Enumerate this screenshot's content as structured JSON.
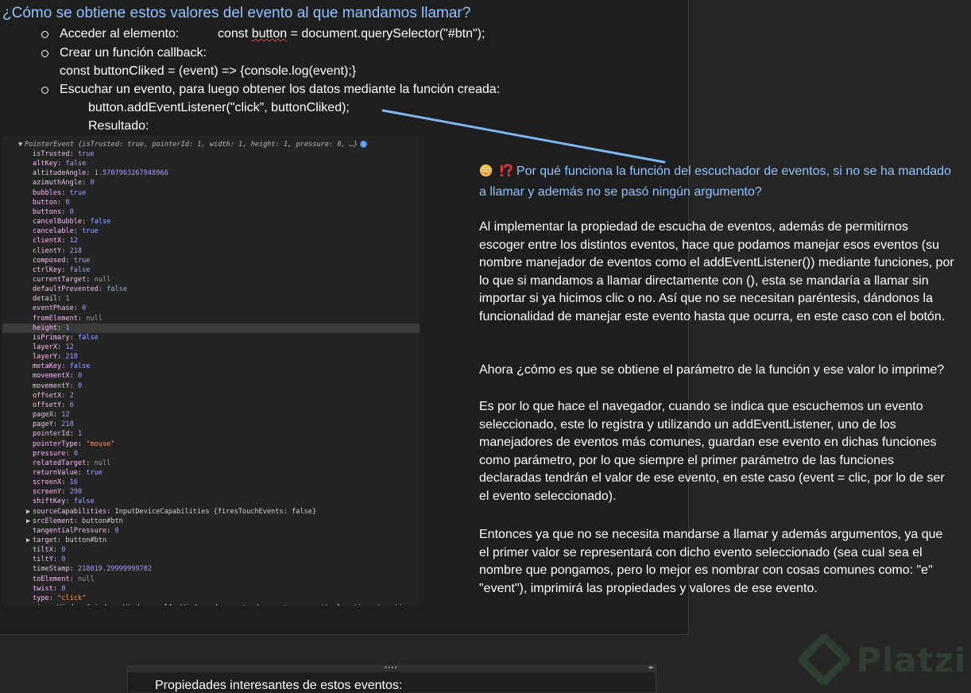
{
  "document": {
    "title": "¿Cómo se obtiene estos valores del evento al que mandamos llamar?",
    "bullets": [
      {
        "label": "Acceder al elemento:",
        "code_pre": "const ",
        "code_squiggle": "button",
        "code_post": " = document.querySelector(\"#btn\");"
      },
      {
        "label": "Crear un función callback:",
        "code": "const buttonCliked = (event) => {console.log(event);}"
      },
      {
        "label": "Escuchar un evento, para luego obtener los datos mediante la función creada:",
        "code": "button.addEventListener(\"click\", buttonCliked);",
        "result_label": "Resultado:"
      }
    ]
  },
  "devtools": {
    "header": "PointerEvent {isTrusted: true, pointerId: 1, width: 1, height: 1, pressure: 0, …}",
    "info_badge": "i",
    "properties": [
      {
        "key": "isTrusted",
        "value": "true",
        "type": "bool"
      },
      {
        "key": "altKey",
        "value": "false",
        "type": "bool"
      },
      {
        "key": "altitudeAngle",
        "value": "1.5707963267948966",
        "type": "num"
      },
      {
        "key": "azimuthAngle",
        "value": "0",
        "type": "num"
      },
      {
        "key": "bubbles",
        "value": "true",
        "type": "bool"
      },
      {
        "key": "button",
        "value": "0",
        "type": "num"
      },
      {
        "key": "buttons",
        "value": "0",
        "type": "num"
      },
      {
        "key": "cancelBubble",
        "value": "false",
        "type": "bool"
      },
      {
        "key": "cancelable",
        "value": "true",
        "type": "bool"
      },
      {
        "key": "clientX",
        "value": "12",
        "type": "num"
      },
      {
        "key": "clientY",
        "value": "218",
        "type": "num"
      },
      {
        "key": "composed",
        "value": "true",
        "type": "bool"
      },
      {
        "key": "ctrlKey",
        "value": "false",
        "type": "bool"
      },
      {
        "key": "currentTarget",
        "value": "null",
        "type": "null"
      },
      {
        "key": "defaultPrevented",
        "value": "false",
        "type": "bool"
      },
      {
        "key": "detail",
        "value": "1",
        "type": "num"
      },
      {
        "key": "eventPhase",
        "value": "0",
        "type": "num"
      },
      {
        "key": "fromElement",
        "value": "null",
        "type": "null"
      },
      {
        "key": "height",
        "value": "1",
        "type": "num",
        "highlight": true
      },
      {
        "key": "isPrimary",
        "value": "false",
        "type": "bool"
      },
      {
        "key": "layerX",
        "value": "12",
        "type": "num"
      },
      {
        "key": "layerY",
        "value": "218",
        "type": "num"
      },
      {
        "key": "metaKey",
        "value": "false",
        "type": "bool"
      },
      {
        "key": "movementX",
        "value": "0",
        "type": "num"
      },
      {
        "key": "movementY",
        "value": "0",
        "type": "num"
      },
      {
        "key": "offsetX",
        "value": "2",
        "type": "num"
      },
      {
        "key": "offsetY",
        "value": "6",
        "type": "num"
      },
      {
        "key": "pageX",
        "value": "12",
        "type": "num"
      },
      {
        "key": "pageY",
        "value": "218",
        "type": "num"
      },
      {
        "key": "pointerId",
        "value": "1",
        "type": "num"
      },
      {
        "key": "pointerType",
        "value": "\"mouse\"",
        "type": "str"
      },
      {
        "key": "pressure",
        "value": "0",
        "type": "num"
      },
      {
        "key": "relatedTarget",
        "value": "null",
        "type": "null"
      },
      {
        "key": "returnValue",
        "value": "true",
        "type": "bool"
      },
      {
        "key": "screenX",
        "value": "16",
        "type": "num"
      },
      {
        "key": "screenY",
        "value": "290",
        "type": "num"
      },
      {
        "key": "shiftKey",
        "value": "false",
        "type": "bool"
      },
      {
        "key": "sourceCapabilities",
        "value": "InputDeviceCapabilities {firesTouchEvents: false}",
        "type": "obj",
        "expandable": true
      },
      {
        "key": "srcElement",
        "value": "button#btn",
        "type": "obj",
        "expandable": true
      },
      {
        "key": "tangentialPressure",
        "value": "0",
        "type": "num"
      },
      {
        "key": "target",
        "value": "button#btn",
        "type": "obj",
        "expandable": true
      },
      {
        "key": "tiltX",
        "value": "0",
        "type": "num"
      },
      {
        "key": "tiltY",
        "value": "0",
        "type": "num"
      },
      {
        "key": "timeStamp",
        "value": "218019.29999999702",
        "type": "num"
      },
      {
        "key": "toElement",
        "value": "null",
        "type": "null"
      },
      {
        "key": "twist",
        "value": "0",
        "type": "num"
      },
      {
        "key": "type",
        "value": "\"click\"",
        "type": "str"
      },
      {
        "key": "view",
        "value": "Window {window: Window, self: Window, document: document, name: '', location: Location, …}",
        "type": "obj",
        "expandable": true
      }
    ]
  },
  "explanation": {
    "question": "Por qué funciona la función del escuchador de eventos, si no se ha mandado a llamar y además no se pasó ningún argumento?",
    "p1": "Al implementar la propiedad de escucha de eventos, además de permitirnos escoger entre los distintos eventos, hace que podamos manejar esos eventos (su nombre manejador de eventos como el addEventListener()) mediante funciones, por lo que si mandamos a llamar directamente con (), esta se mandaría a llamar sin importar si ya hicimos clic o no. Así que no se necesitan paréntesis, dándonos la funcionalidad de manejar este evento hasta que ocurra, en este caso con el botón.",
    "p2_q": "Ahora ¿cómo es que se obtiene el parámetro de la función y ese valor lo imprime?",
    "p2": "Es por lo que hace el navegador, cuando se indica que escuchemos un evento seleccionado, este lo registra y utilizando un addEventListener, uno de los manejadores de eventos más comunes, guardan ese evento en dichas funciones como parámetro, por lo que siempre el primer parámetro de las funciones declaradas tendrán el valor de ese evento, en este caso (event = clic, por lo de ser el evento seleccionado).",
    "p3": "Entonces ya que no se necesita mandarse a llamar y además argumentos, ya que el primer valor se representará con dicho evento seleccionado (sea cual sea el nombre que pongamos, pero lo mejor es nombrar con cosas comunes como: \"e\" \"event\"), imprimirá las propiedades y valores de ese evento."
  },
  "watermark": {
    "text": "Platzi"
  },
  "panel2": {
    "text": "Propiedades interesantes de estos eventos:",
    "grip": "••••",
    "arrows": "◂▸"
  },
  "colors": {
    "page_bg": "#1e1e1e",
    "outer_bg": "#262626",
    "heading": "#8fc4ff",
    "pointer_line": "#7ab8ee",
    "console_key": "#f7bdf4",
    "console_value": "#9ba8ff"
  }
}
